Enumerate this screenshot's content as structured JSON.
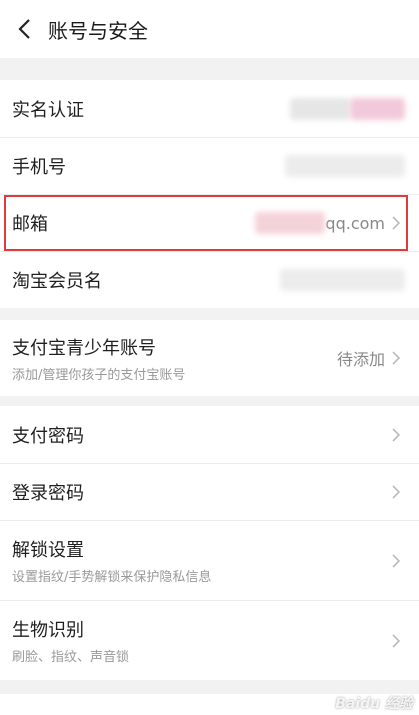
{
  "header": {
    "title": "账号与安全"
  },
  "section1": {
    "real_name_label": "实名认证",
    "phone_label": "手机号",
    "email_label": "邮箱",
    "email_value": "qq.com",
    "taobao_label": "淘宝会员名"
  },
  "section2": {
    "teen_label": "支付宝青少年账号",
    "teen_sub": "添加/管理你孩子的支付宝账号",
    "teen_value": "待添加"
  },
  "section3": {
    "pay_pwd_label": "支付密码",
    "login_pwd_label": "登录密码",
    "unlock_label": "解锁设置",
    "unlock_sub": "设置指纹/手势解锁来保护隐私信息",
    "bio_label": "生物识别",
    "bio_sub": "刷脸、指纹、声音锁"
  },
  "watermark": "Baidu 经验",
  "colors": {
    "highlight": "#e23a3a",
    "background": "#f2f2f2"
  }
}
